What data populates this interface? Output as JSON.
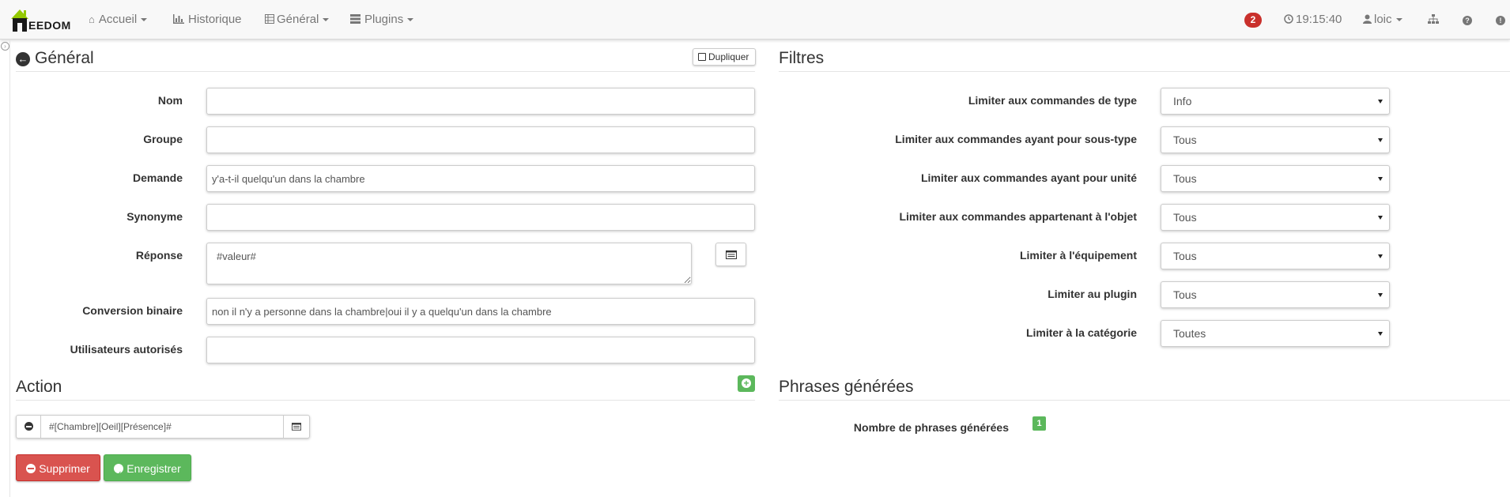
{
  "navbar": {
    "brand": "EEDOM",
    "menu": [
      {
        "label": "Accueil",
        "icon": "home-icon",
        "dropdown": true
      },
      {
        "label": "Historique",
        "icon": "bar-chart-icon",
        "dropdown": false
      },
      {
        "label": "Général",
        "icon": "grid-icon",
        "dropdown": true
      },
      {
        "label": "Plugins",
        "icon": "list-icon",
        "dropdown": true
      }
    ],
    "notifications": "2",
    "time": "19:15:40",
    "user": "loic"
  },
  "general": {
    "title": "Général",
    "duplicate_label": "Dupliquer",
    "fields": {
      "nom": {
        "label": "Nom",
        "value": ""
      },
      "groupe": {
        "label": "Groupe",
        "value": ""
      },
      "demande": {
        "label": "Demande",
        "value": "y'a-t-il quelqu'un dans la chambre"
      },
      "synonyme": {
        "label": "Synonyme",
        "value": ""
      },
      "reponse": {
        "label": "Réponse",
        "value": "#valeur#"
      },
      "conversion": {
        "label": "Conversion binaire",
        "value": "non il n'y a personne dans la chambre|oui il y a quelqu'un dans la chambre"
      },
      "utilisateurs": {
        "label": "Utilisateurs autorisés",
        "value": ""
      }
    }
  },
  "action": {
    "title": "Action",
    "command": "#[Chambre][Oeil][Présence]#"
  },
  "buttons": {
    "delete": "Supprimer",
    "save": "Enregistrer"
  },
  "filtres": {
    "title": "Filtres",
    "items": [
      {
        "label": "Limiter aux commandes de type",
        "value": "Info"
      },
      {
        "label": "Limiter aux commandes ayant pour sous-type",
        "value": "Tous"
      },
      {
        "label": "Limiter aux commandes ayant pour unité",
        "value": "Tous"
      },
      {
        "label": "Limiter aux commandes appartenant à l'objet",
        "value": "Tous"
      },
      {
        "label": "Limiter à l'équipement",
        "value": "Tous"
      },
      {
        "label": "Limiter au plugin",
        "value": "Tous"
      },
      {
        "label": "Limiter à la catégorie",
        "value": "Toutes"
      }
    ]
  },
  "phrases": {
    "title": "Phrases générées",
    "count_label": "Nombre de phrases générées",
    "count": "1"
  }
}
